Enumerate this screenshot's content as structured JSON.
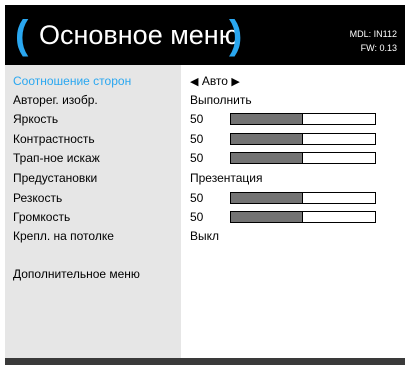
{
  "header": {
    "paren_open": "(",
    "title": "Основное меню",
    "paren_close": ")",
    "model": "MDL: IN112",
    "firmware": "FW: 0.13"
  },
  "colors": {
    "accent": "#2aa7f0",
    "header_bg": "#000000",
    "panel_bg": "#e6e6e6",
    "bar_fill": "#737373"
  },
  "menu": {
    "aspect": {
      "label": "Соотношение сторон",
      "value": "Авто",
      "prev_icon": "◀",
      "next_icon": "▶"
    },
    "auto_image": {
      "label": "Авторег. изобр.",
      "value": "Выполнить"
    },
    "brightness": {
      "label": "Яркость",
      "value": "50",
      "level": 0.5
    },
    "contrast": {
      "label": "Контрастность",
      "value": "50",
      "level": 0.5
    },
    "keystone": {
      "label": "Трап-ное искаж",
      "value": "50",
      "level": 0.5
    },
    "preset": {
      "label": "Предустановки",
      "value": "Презентация"
    },
    "sharpness": {
      "label": "Резкость",
      "value": "50",
      "level": 0.5
    },
    "volume": {
      "label": "Громкость",
      "value": "50",
      "level": 0.5
    },
    "ceiling": {
      "label": "Крепл. на потолке",
      "value": "Выкл"
    },
    "advanced": {
      "label": "Дополнительное меню"
    }
  }
}
